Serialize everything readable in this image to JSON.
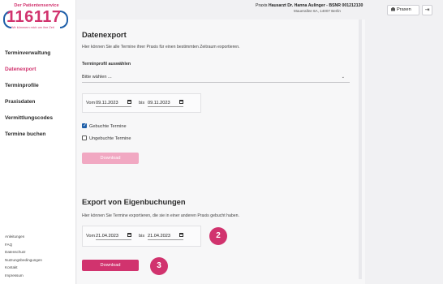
{
  "logo": {
    "tagline": "Der Patientenservice",
    "number": "116117",
    "subline": "Wir kümmern mich um ihre Zeit"
  },
  "sidebar": {
    "items": [
      {
        "label": "Terminverwaltung",
        "active": false
      },
      {
        "label": "Datenexport",
        "active": true
      },
      {
        "label": "Terminprofile",
        "active": false
      },
      {
        "label": "Praxisdaten",
        "active": false
      },
      {
        "label": "Vermittlungscodes",
        "active": false
      },
      {
        "label": "Termine buchen",
        "active": false
      }
    ],
    "footer": [
      "Anleitungen",
      "FAQ",
      "Datenschutz",
      "Nutzungsbedingungen",
      "Kontakt",
      "Impressum"
    ]
  },
  "header": {
    "praxis_label": "Praxis",
    "praxis_name": "Hausarzt Dr. Hanna Aulinger - BSNR 001212130",
    "address": "Mauerallee 6A, 14007 Berlin",
    "praxen_button": "Praxen",
    "logout_icon": "logout-icon"
  },
  "export": {
    "title": "Datenexport",
    "description": "Hier können Sie alle Termine ihrer Praxis für einen bestimmten Zeitraum exportieren.",
    "profile_label": "Terminprofil auswählen",
    "profile_select": "Bitte wählen ...",
    "from_label": "Vom",
    "from_date": "09.11.2023",
    "to_label": "bis",
    "to_date": "09.11.2023",
    "checkbox_booked": "Gebuchte Termine",
    "checkbox_booked_checked": true,
    "checkbox_unbooked": "Ungebuchte Termine",
    "checkbox_unbooked_checked": false,
    "download_label": "Download"
  },
  "own_export": {
    "title": "Export von Eigenbuchungen",
    "description": "Hier können Sie Termine exportieren, die sie in einer anderen Praxis gebucht haben.",
    "from_label": "Vom",
    "from_date": "21.04.2023",
    "to_label": "bis",
    "to_date": "21.04.2023",
    "download_label": "Download"
  },
  "annotations": {
    "badge_2": "2",
    "badge_3": "3"
  },
  "colors": {
    "accent": "#d1336e",
    "accent_disabled": "#f1a8c2",
    "logo_blue": "#1d5ea8"
  }
}
